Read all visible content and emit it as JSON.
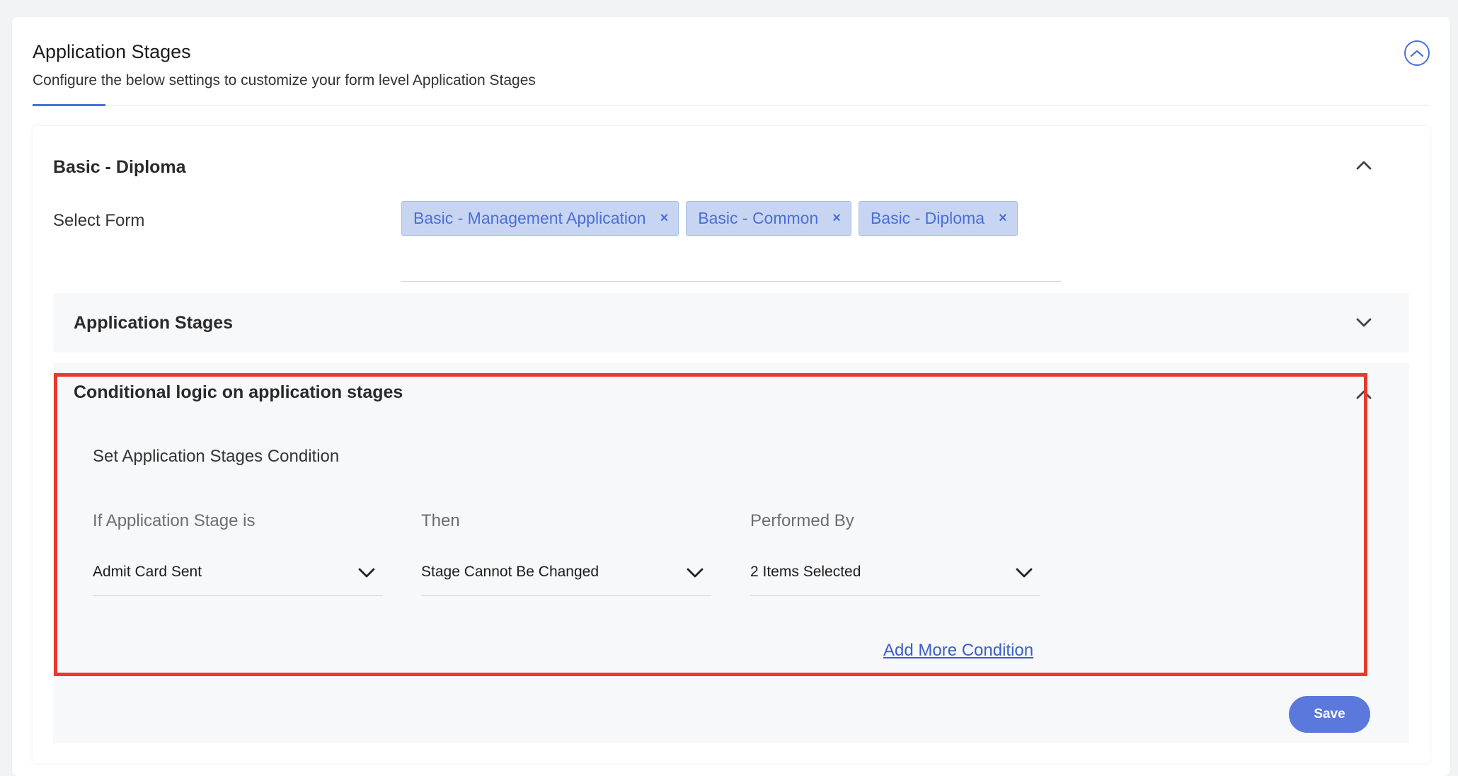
{
  "header": {
    "title": "Application Stages",
    "subtitle": "Configure the below settings to customize your form level Application Stages"
  },
  "form_section": {
    "title": "Basic - Diploma",
    "select_form_label": "Select Form",
    "chips": [
      {
        "label": "Basic - Management Application",
        "remove": "×"
      },
      {
        "label": "Basic - Common",
        "remove": "×"
      },
      {
        "label": "Basic - Diploma",
        "remove": "×"
      }
    ]
  },
  "stages_accordion": {
    "title": "Application Stages"
  },
  "conditional": {
    "title": "Conditional logic on application stages",
    "subtitle": "Set Application Stages Condition",
    "columns": [
      {
        "label": "If Application Stage is",
        "value": "Admit Card Sent"
      },
      {
        "label": "Then",
        "value": "Stage Cannot Be Changed"
      },
      {
        "label": "Performed By",
        "value": "2 Items Selected"
      }
    ],
    "add_more_label": "Add More Condition"
  },
  "save_label": "Save",
  "colors": {
    "accent": "#4a6fd6",
    "chip_bg": "#c8d5f2",
    "highlight": "#e53a2c",
    "save_button": "#5b79dc"
  }
}
